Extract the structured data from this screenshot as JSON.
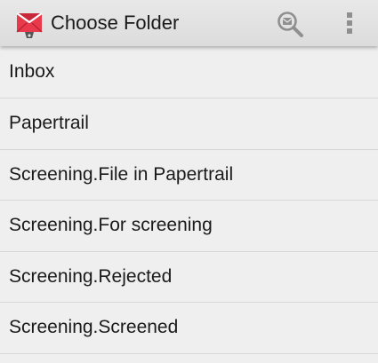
{
  "header": {
    "title": "Choose Folder",
    "logo_icon": "k9-mail-envelope-logo",
    "search_icon": "search-folder-icon",
    "overflow_icon": "overflow-menu-icon"
  },
  "folders": [
    {
      "label": "Inbox"
    },
    {
      "label": "Papertrail"
    },
    {
      "label": "Screening.File in Papertrail"
    },
    {
      "label": "Screening.For screening"
    },
    {
      "label": "Screening.Rejected"
    },
    {
      "label": "Screening.Screened"
    }
  ],
  "colors": {
    "action_bar": "#e0e0e0",
    "background": "#efefef",
    "divider": "#d6d6d6",
    "logo_red": "#e83a4b",
    "icon_gray": "#8f8f8f",
    "text": "#1a1a1a"
  }
}
